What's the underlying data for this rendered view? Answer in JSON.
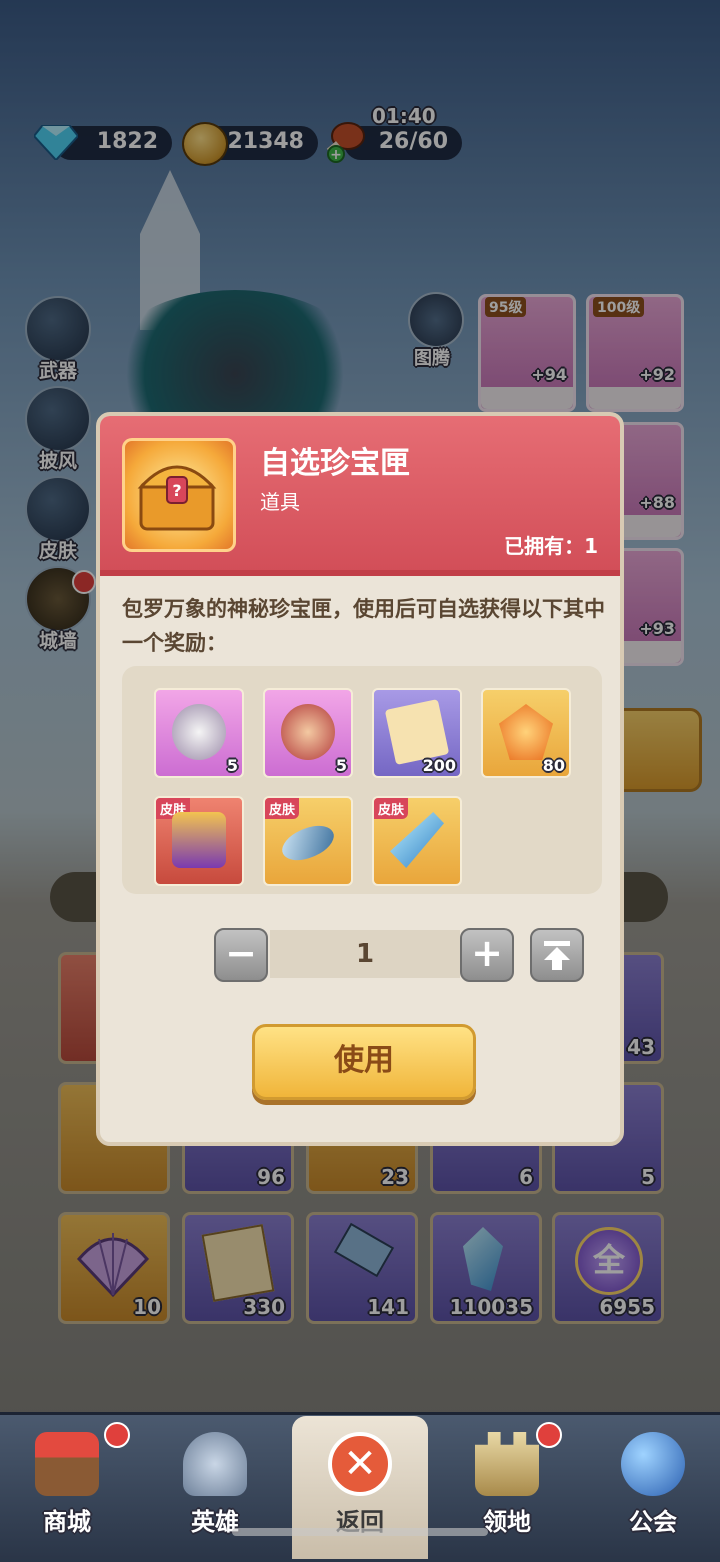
{
  "resources": {
    "gems": "1822",
    "coins": "21348",
    "stamina_timer": "01:40",
    "stamina": "26/60"
  },
  "side_menu": [
    {
      "label": "武器"
    },
    {
      "label": "披风"
    },
    {
      "label": "皮肤"
    },
    {
      "label": "城墙"
    }
  ],
  "totem_label": "图腾",
  "equip_cards": [
    {
      "level": "95级",
      "plus": "+94"
    },
    {
      "level": "100级",
      "plus": "+92"
    },
    {
      "plus": "+88"
    },
    {
      "plus": "+93"
    }
  ],
  "inventory_counts": [
    "43",
    "96",
    "23",
    "6",
    "5",
    "10",
    "330",
    "141",
    "110035",
    "6955"
  ],
  "inventory_glyph": "全",
  "modal": {
    "title": "自选珍宝匣",
    "subtitle": "道具",
    "owned": "已拥有：1",
    "description": "包罗万象的神秘珍宝匣，使用后可自选获得以下其中一个奖励：",
    "rewards": [
      {
        "qty": "5",
        "tag": ""
      },
      {
        "qty": "5",
        "tag": ""
      },
      {
        "qty": "200",
        "tag": ""
      },
      {
        "qty": "80",
        "tag": ""
      },
      {
        "qty": "",
        "tag": "皮肤"
      },
      {
        "qty": "",
        "tag": "皮肤"
      },
      {
        "qty": "",
        "tag": "皮肤"
      }
    ],
    "quantity": "1",
    "use_label": "使用"
  },
  "nav": [
    {
      "label": "商城"
    },
    {
      "label": "英雄"
    },
    {
      "label": "返回"
    },
    {
      "label": "领地"
    },
    {
      "label": "公会"
    }
  ],
  "colors": {
    "modal_header": "#d24e58",
    "modal_body": "#ebe4d8",
    "use_button": "#f0b53a",
    "badge_red": "#e0403c"
  }
}
